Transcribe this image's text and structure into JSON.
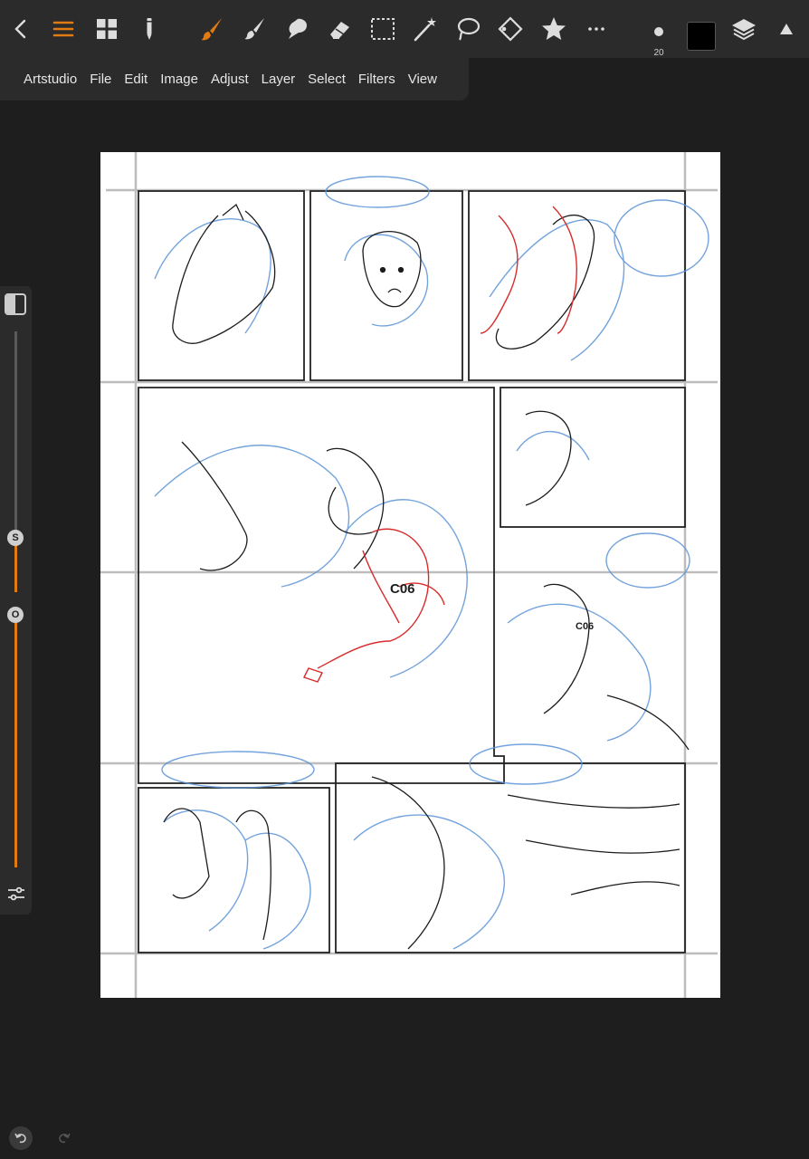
{
  "menu": {
    "items": [
      "Artstudio",
      "File",
      "Edit",
      "Image",
      "Adjust",
      "Layer",
      "Select",
      "Filters",
      "View"
    ]
  },
  "toolbar": {
    "brush_size": "20",
    "current_color": "#000000",
    "accent_color": "#e07b12",
    "tools": [
      "back-icon",
      "menu-icon",
      "gallery-icon",
      "pencil-icon",
      "brush-icon",
      "smudge-icon",
      "smear-icon",
      "eraser-icon",
      "rect-select-icon",
      "magic-wand-icon",
      "lasso-icon",
      "transform-icon",
      "star-icon",
      "more-icon"
    ]
  },
  "side_panel": {
    "size_knob_label": "S",
    "opacity_knob_label": "O",
    "size_value": 0.2,
    "opacity_value": 0.35
  }
}
